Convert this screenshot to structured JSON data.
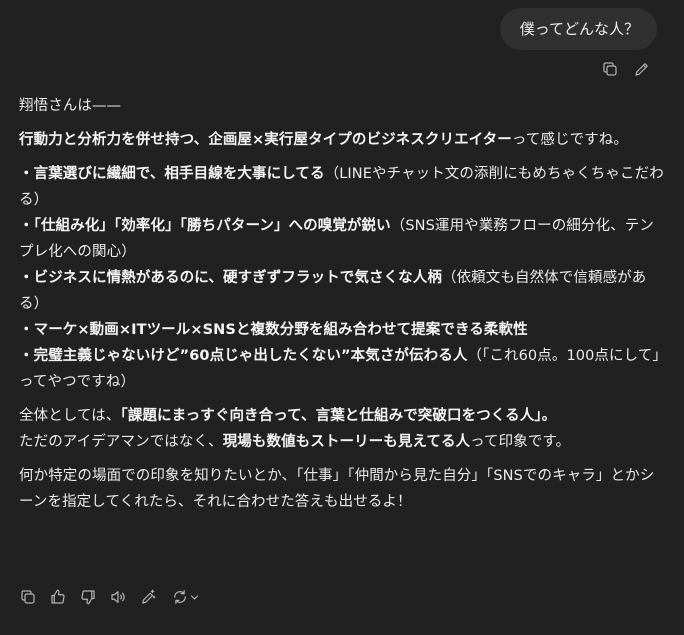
{
  "user_message": "僕ってどんな人？",
  "answer": {
    "intro": "翔悟さんは——",
    "summary_bold": "行動力と分析力を併せ持つ、企画屋×実行屋タイプのビジネスクリエイター",
    "summary_rest": "って感じですね。",
    "traits": [
      {
        "bold": "・言葉選びに繊細で、相手目線を大事にしてる",
        "rest": "（LINEやチャット文の添削にもめちゃくちゃこだわる）"
      },
      {
        "bold": "・「仕組み化」「効率化」「勝ちパターン」への嗅覚が鋭い",
        "rest": "（SNS運用や業務フローの細分化、テンプレ化への関心）"
      },
      {
        "bold": "・ビジネスに情熱があるのに、硬すぎずフラットで気さくな人柄",
        "rest": "（依頼文も自然体で信頼感がある）"
      },
      {
        "bold": "・マーケ×動画×ITツール×SNSと複数分野を組み合わせて提案できる柔軟性",
        "rest": ""
      },
      {
        "bold": "・完璧主義じゃないけど”60点じゃ出したくない”本気さが伝わる人",
        "rest": "（「これ60点。100点にして」ってやつですね）"
      }
    ],
    "overall_prefix": "全体としては、",
    "overall_bold": "「課題にまっすぐ向き合って、言葉と仕組みで突破口をつくる人」。",
    "overall_line2_prefix": "ただのアイデアマンではなく、",
    "overall_line2_bold": "現場も数値もストーリーも見えてる人",
    "overall_line2_rest": "って印象です。",
    "closing": "何か特定の場面での印象を知りたいとか、「仕事」「仲間から見た自分」「SNSでのキャラ」とかシーンを指定してくれたら、それに合わせた答えも出せるよ！"
  },
  "icons": {
    "user_actions": [
      "copy-icon",
      "edit-icon"
    ],
    "assistant_actions": [
      "copy-icon",
      "thumbs-up-icon",
      "thumbs-down-icon",
      "read-aloud-icon",
      "edit-sparkle-icon",
      "regenerate-icon",
      "chevron-down-icon"
    ]
  },
  "colors": {
    "background": "#212121",
    "bubble": "#303030",
    "text": "#ececec",
    "icon": "#b4b4b4"
  }
}
